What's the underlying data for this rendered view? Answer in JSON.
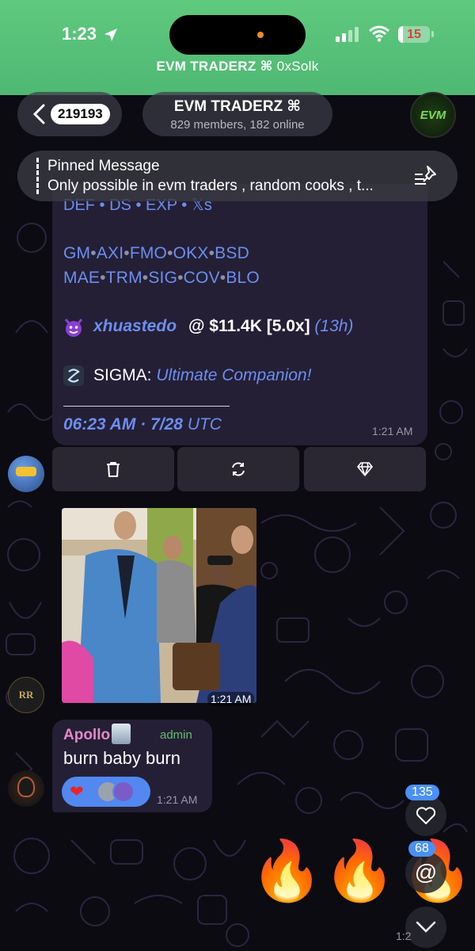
{
  "status_bar": {
    "time": "1:23",
    "battery": "15",
    "call_banner_title": "EVM TRADERZ ⌘",
    "call_banner_sub": "0xSolk"
  },
  "header": {
    "unread_count": "219193",
    "title": "EVM TRADERZ ⌘",
    "subtitle": "829 members, 182 online",
    "avatar_text": "EVM"
  },
  "pinned": {
    "title": "Pinned Message",
    "text": "Only possible in evm traders , random cooks , t..."
  },
  "bot_message": {
    "cut_line": "DEF • DS • EXP • 𝕏s",
    "links_row1": [
      "GM",
      "AXI",
      "FMO",
      "OKX",
      "BSD"
    ],
    "links_row2": [
      "MAE",
      "TRM",
      "SIG",
      "COV",
      "BLO"
    ],
    "user": "xhuastedo",
    "user_stats": "@ $11.4K [5.0x]",
    "user_age": "(13h)",
    "sigma_label": "SIGMA:",
    "sigma_tagline": "Ultimate Companion!",
    "date_main": "06:23 AM · 7/28",
    "date_tz": "UTC",
    "time": "1:21 AM",
    "buttons": [
      "trash-icon",
      "refresh-icon",
      "diamond-icon"
    ]
  },
  "photo_message": {
    "time": "1:21 AM"
  },
  "apollo_message": {
    "sender": "Apollo",
    "role": "admin",
    "text": "burn baby burn",
    "reaction": "❤",
    "time": "1:21 AM"
  },
  "side_controls": {
    "reactions_count": "135",
    "mentions_count": "68",
    "mention_symbol": "@"
  },
  "footer": {
    "partial_time": "1:2"
  },
  "colors": {
    "status_bar": "#5fc97e",
    "link": "#6c8ef0",
    "bubble": "#241f35",
    "admin": "#5fbf6a",
    "sender": "#e389c9",
    "reaction": "#5288f0"
  }
}
